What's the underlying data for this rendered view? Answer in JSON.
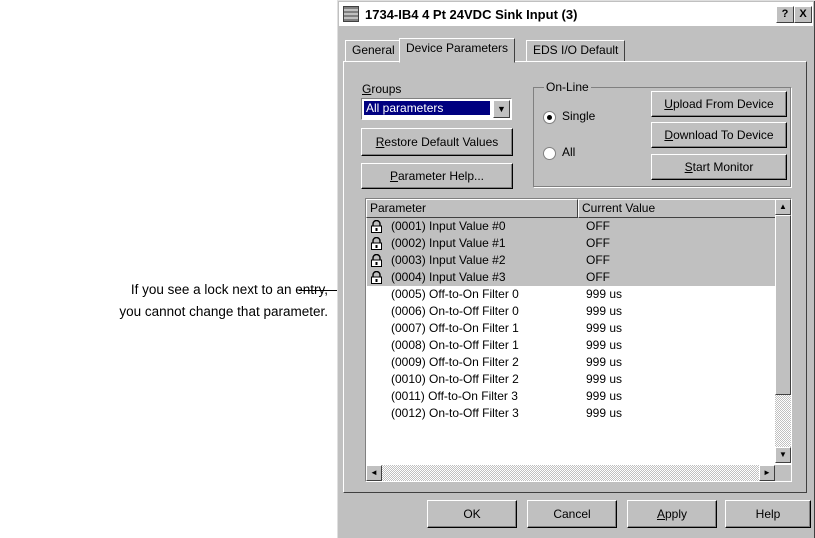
{
  "annotation": {
    "line1": "If you see a lock next to an entry,",
    "line2": "you cannot change that parameter."
  },
  "window": {
    "title": "1734-IB4 4 Pt 24VDC Sink Input (3)",
    "help_btn": "?",
    "close_btn": "X"
  },
  "tabs": [
    {
      "label": "General"
    },
    {
      "label": "Device Parameters"
    },
    {
      "label": "EDS I/O Default"
    }
  ],
  "groups": {
    "label_first": "G",
    "label_rest": "roups",
    "selected": "All parameters"
  },
  "buttons": {
    "restore_ul": "R",
    "restore_rest": "estore Default Values",
    "help_ul": "P",
    "help_rest": "arameter Help...",
    "upload_ul": "U",
    "upload_rest": "pload From Device",
    "download_ul": "D",
    "download_rest": "ownload To Device",
    "monitor_ul": "S",
    "monitor_rest": "tart Monitor"
  },
  "online": {
    "title": "On-Line",
    "single": "Single",
    "all": "All",
    "selected": "Single"
  },
  "table": {
    "col_parameter": "Parameter",
    "col_value": "Current Value",
    "rows": [
      {
        "param": "(0001) Input Value #0",
        "value": "OFF",
        "locked": true
      },
      {
        "param": "(0002) Input Value #1",
        "value": "OFF",
        "locked": true
      },
      {
        "param": "(0003) Input Value #2",
        "value": "OFF",
        "locked": true
      },
      {
        "param": "(0004) Input Value #3",
        "value": "OFF",
        "locked": true
      },
      {
        "param": "(0005) Off-to-On Filter 0",
        "value": "999 us",
        "locked": false
      },
      {
        "param": "(0006) On-to-Off Filter 0",
        "value": "999 us",
        "locked": false
      },
      {
        "param": "(0007) Off-to-On Filter 1",
        "value": "999 us",
        "locked": false
      },
      {
        "param": "(0008) On-to-Off Filter 1",
        "value": "999 us",
        "locked": false
      },
      {
        "param": "(0009) Off-to-On Filter 2",
        "value": "999 us",
        "locked": false
      },
      {
        "param": "(0010) On-to-Off Filter 2",
        "value": "999 us",
        "locked": false
      },
      {
        "param": "(0011) Off-to-On Filter 3",
        "value": "999 us",
        "locked": false
      },
      {
        "param": "(0012) On-to-Off Filter 3",
        "value": "999 us",
        "locked": false
      }
    ]
  },
  "footer": {
    "ok": "OK",
    "cancel": "Cancel",
    "apply_ul": "A",
    "apply_rest": "pply",
    "help": "Help"
  }
}
